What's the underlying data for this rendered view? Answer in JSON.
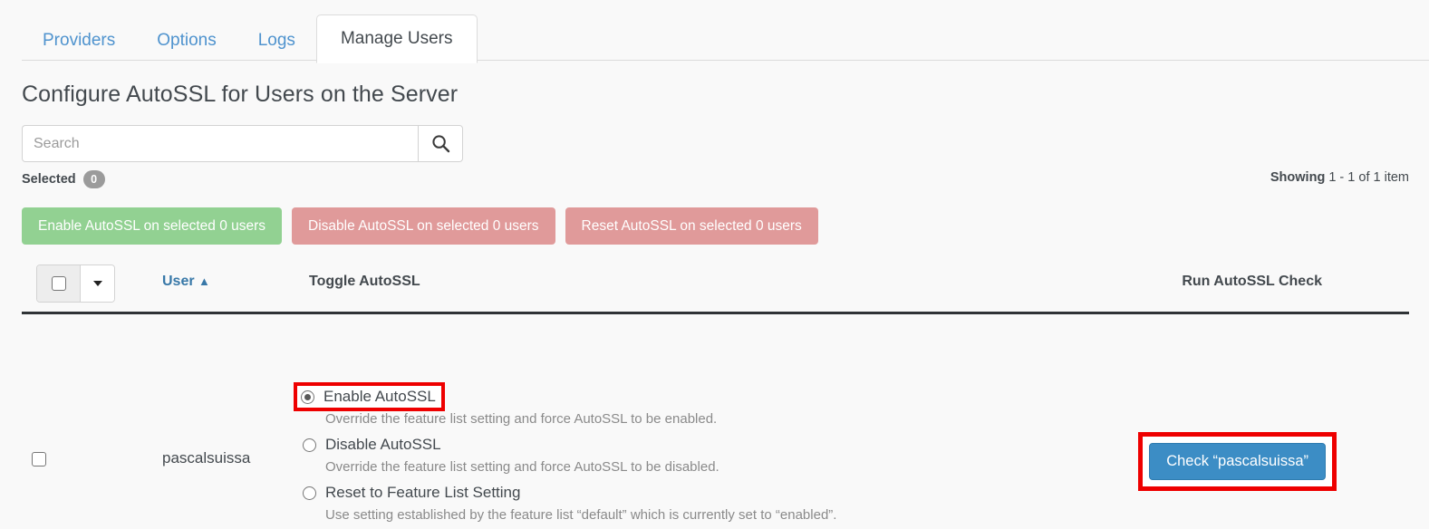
{
  "tabs": [
    {
      "label": "Providers",
      "active": false
    },
    {
      "label": "Options",
      "active": false
    },
    {
      "label": "Logs",
      "active": false
    },
    {
      "label": "Manage Users",
      "active": true
    }
  ],
  "page_title": "Configure AutoSSL for Users on the Server",
  "search": {
    "placeholder": "Search",
    "value": "",
    "icon": "search-icon"
  },
  "selected": {
    "label": "Selected",
    "count": "0"
  },
  "showing": {
    "label": "Showing",
    "range": "1 - 1 of 1 item"
  },
  "bulk_actions": [
    {
      "label": "Enable AutoSSL on selected 0 users",
      "style": "green",
      "color": "#92d192"
    },
    {
      "label": "Disable AutoSSL on selected 0 users",
      "style": "red",
      "color": "#e09a9a"
    },
    {
      "label": "Reset AutoSSL on selected 0 users",
      "style": "red",
      "color": "#e09a9a"
    }
  ],
  "table": {
    "headers": {
      "user": "User",
      "sort_indicator": "▲",
      "toggle": "Toggle AutoSSL",
      "run_check": "Run AutoSSL Check"
    },
    "rows": [
      {
        "username": "pascalsuissa",
        "checked": false,
        "options": [
          {
            "label": "Enable AutoSSL",
            "description": "Override the feature list setting and force AutoSSL to be enabled.",
            "selected": true,
            "highlighted": true
          },
          {
            "label": "Disable AutoSSL",
            "description": "Override the feature list setting and force AutoSSL to be disabled.",
            "selected": false,
            "highlighted": false
          },
          {
            "label": "Reset to Feature List Setting",
            "description": "Use setting established by the feature list “default” which is currently set to “enabled”.",
            "selected": false,
            "highlighted": false
          }
        ],
        "check_button": "Check “pascalsuissa”"
      }
    ]
  },
  "annotation": {
    "color": "#ee0000"
  }
}
